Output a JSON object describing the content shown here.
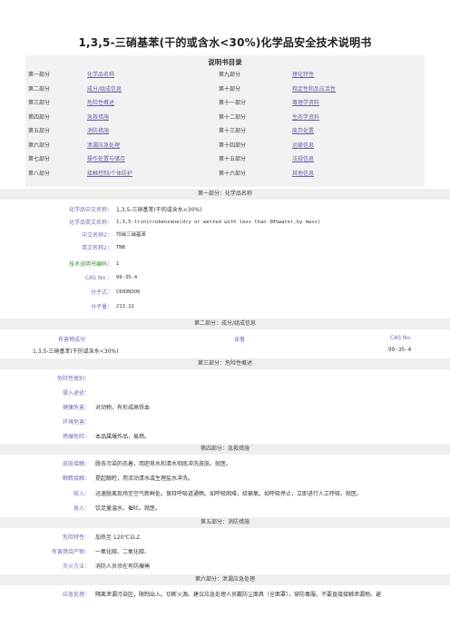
{
  "title": "1,3,5-三硝基苯(干的或含水<30%)化学品安全技术说明书",
  "toc": {
    "heading": "说明书目录",
    "rows": [
      {
        "p1": "第一部分",
        "n1": "化学品名称",
        "p2": "第九部分",
        "n2": "理化特性"
      },
      {
        "p1": "第二部分",
        "n1": "成分/组成信息",
        "p2": "第十部分",
        "n2": "稳定性和反应活性"
      },
      {
        "p1": "第三部分",
        "n1": "危险性概述",
        "p2": "第十一部分",
        "n2": "毒理学资料"
      },
      {
        "p1": "第四部分",
        "n1": "急救措施",
        "p2": "第十二部分",
        "n2": "生态学资料"
      },
      {
        "p1": "第五部分",
        "n1": "消防措施",
        "p2": "第十三部分",
        "n2": "废弃处置"
      },
      {
        "p1": "第六部分",
        "n1": "泄漏应急处理",
        "p2": "第十四部分",
        "n2": "运输信息"
      },
      {
        "p1": "第七部分",
        "n1": "操作处置与储存",
        "p2": "第十五部分",
        "n2": "法规信息"
      },
      {
        "p1": "第八部分",
        "n1": "接触控制/个体防护",
        "p2": "第十六部分",
        "n2": "其他信息"
      }
    ]
  },
  "s1": {
    "heading": "第一部分：化学品名称",
    "rows": [
      {
        "label": "化学品中文名称：",
        "value": "1,3,5-三硝基苯(干的或含水<30%)"
      },
      {
        "label": "化学品英文名称：",
        "value": "1,3,5-trinitrobenzene(dry or wetted with less than 30%water,by mass)"
      },
      {
        "label": "中文名称2：",
        "value": "均硝三硝基苯"
      },
      {
        "label": "英文名称2：",
        "value": "TNB"
      },
      {
        "label": "技术说明书编码：",
        "value": "1"
      },
      {
        "label": "CAS No.：",
        "value": "99-35-4"
      },
      {
        "label": "分子式：",
        "value": "C6H3N3O6"
      },
      {
        "label": "分子量：",
        "value": "213.11"
      }
    ]
  },
  "s2": {
    "heading": "第二部分：成分/组成信息",
    "col1": "有害物成分",
    "col2": "含量",
    "col3": "CAS No.",
    "name": "1,3,5-三硝基苯(干的或含水<30%)",
    "cas": "99-35-4"
  },
  "s3": {
    "heading": "第三部分：危险性概述",
    "rows": [
      {
        "label": "危险性类别：",
        "value": ""
      },
      {
        "label": "侵入途径：",
        "value": ""
      },
      {
        "label": "健康危害：",
        "value": "对动物，有形成高铁血"
      },
      {
        "label": "环境危害：",
        "value": ""
      },
      {
        "label": "燃爆危险：",
        "value": "本品属爆炸品，易燃。"
      }
    ]
  },
  "s4": {
    "heading": "第四部分：急救措施",
    "rows": [
      {
        "label": "皮肤接触：",
        "value": "脱去污染的衣着，用肥皂水和清水彻底冲洗皮肤。就医。"
      },
      {
        "label": "眼睛接触：",
        "value": "提起眼睑，用流动清水或生理盐水冲洗。"
      },
      {
        "label": "吸入：",
        "value": "迅速脱离现场至空气新鲜处。保持呼吸道通畅。如呼吸困难，给输氧。如呼吸停止，立即进行人工呼吸。就医。"
      },
      {
        "label": "食入：",
        "value": "饮足量温水，催吐。就医。"
      }
    ]
  },
  "s5": {
    "heading": "第五部分：消防措施",
    "rows": [
      {
        "label": "危险特性：",
        "value": "加热至 120℃以上"
      },
      {
        "label": "有害燃烧产物：",
        "value": "一氧化碳、二氧化碳、"
      },
      {
        "label": "灭火方法：",
        "value": "消防人员须在有防爆掩"
      }
    ]
  },
  "s6": {
    "heading": "第六部分：泄漏应急处理",
    "rows": [
      {
        "label": "应急处理：",
        "value": "隔离泄漏污染区，限制出入。切断火源。建议应急处理人员戴防尘面具（全面罩），穿防毒服。不要直接接触泄漏物。避"
      }
    ]
  }
}
